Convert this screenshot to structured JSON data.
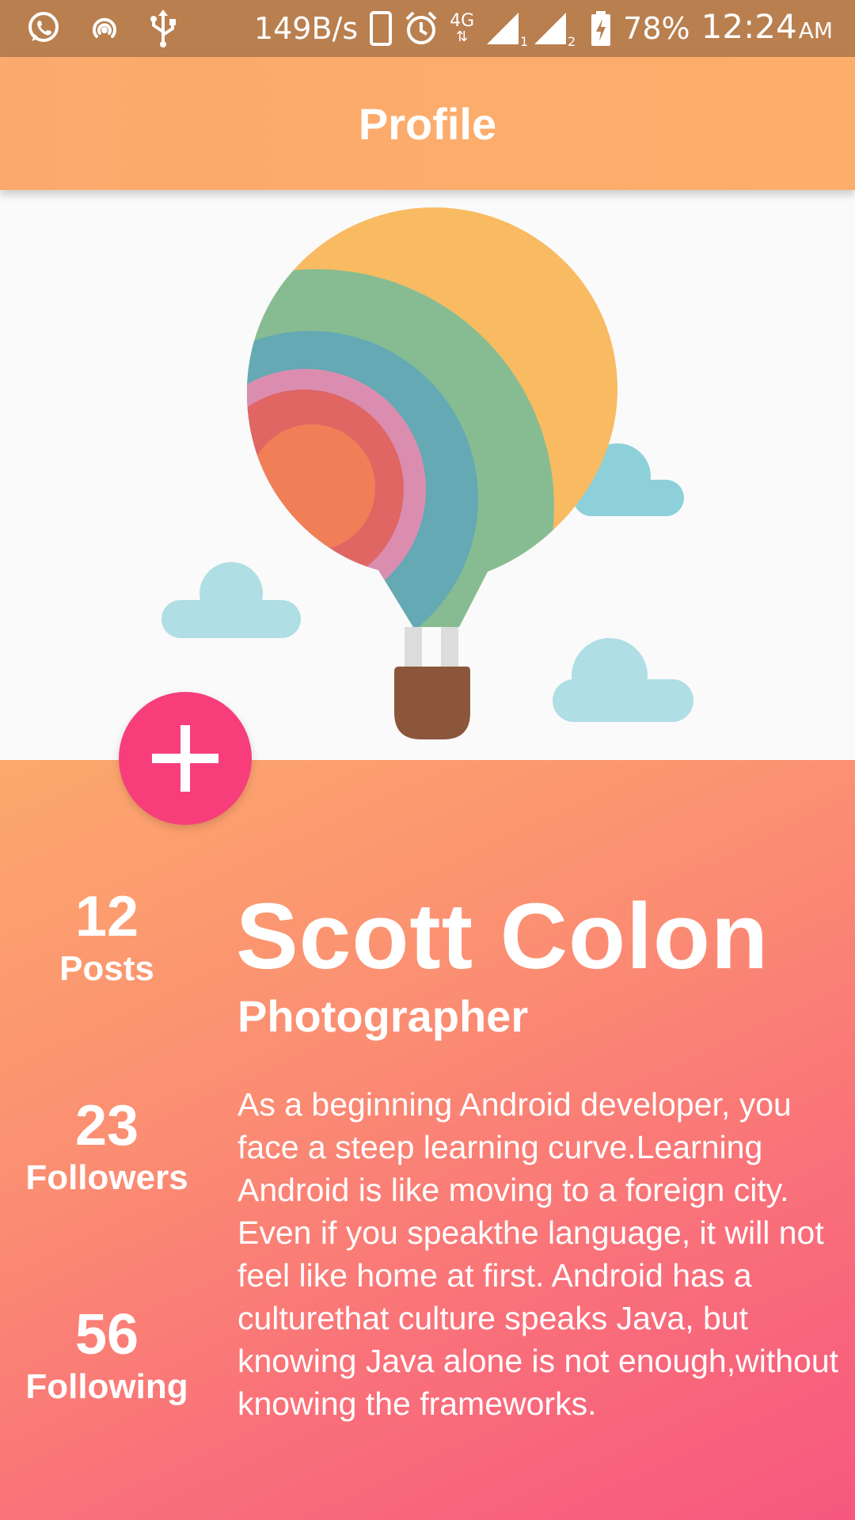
{
  "status_bar": {
    "network_speed": "149B/s",
    "network_type": "4G",
    "sim1_label": "1",
    "sim2_label": "2",
    "battery_percent": "78%",
    "time": "12:24",
    "ampm": "AM",
    "icons": [
      "whatsapp-icon",
      "hotspot-icon",
      "usb-icon",
      "phone-icon",
      "alarm-icon",
      "signal-icon",
      "battery-charging-icon"
    ]
  },
  "app_bar": {
    "title": "Profile"
  },
  "fab": {
    "icon": "plus-icon",
    "color": "#f73e7b"
  },
  "stats": [
    {
      "value": "12",
      "label": "Posts"
    },
    {
      "value": "23",
      "label": "Followers"
    },
    {
      "value": "56",
      "label": "Following"
    }
  ],
  "profile": {
    "name": "Scott Colon",
    "role": "Photographer",
    "bio": "As a beginning Android developer, you face a steep learning curve.Learning Android is like moving to a foreign city. Even if you speakthe language, it will not feel like home at first. Android has a culturethat culture speaks Java, but knowing Java alone is not enough,without knowing the frameworks."
  },
  "colors": {
    "status_bar": "#b97f4f",
    "app_bar": "#fca96d",
    "panel_gradient_start": "#fca86c",
    "panel_gradient_end": "#f7577f",
    "hero_background": "#fafafa"
  },
  "hero_illustration": {
    "icon": "hot-air-balloon-illustration"
  }
}
